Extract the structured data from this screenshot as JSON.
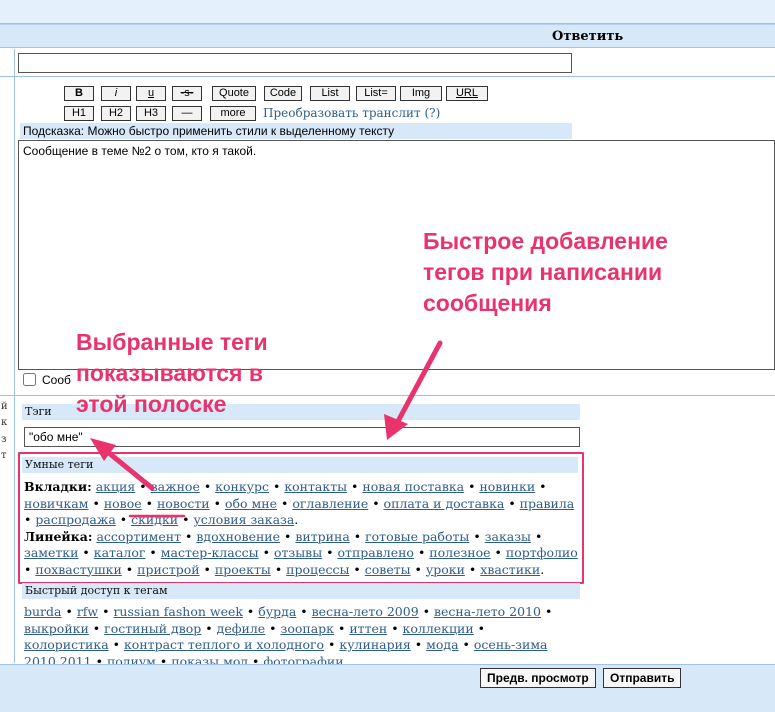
{
  "header": {
    "title": "Ответить"
  },
  "subject": {
    "value": ""
  },
  "toolbar": {
    "row1": [
      "B",
      "i",
      "u",
      "-s-",
      "Quote",
      "Code",
      "List",
      "List=",
      "Img",
      "URL"
    ],
    "row2": [
      "H1",
      "H2",
      "H3",
      "—",
      "more"
    ],
    "translit": "Преобразовать транслит (?)"
  },
  "hint": "Подсказка: Можно быстро применить стили к выделенному тексту",
  "message": {
    "value": "Сообщение в теме №2 о том, кто я такой."
  },
  "signature_label": "Сооб",
  "sidebar_marks": [
    "й",
    "к",
    "з",
    "т"
  ],
  "tags": {
    "section_title": "Тэги",
    "value": "\"обо мне\""
  },
  "smart_tags": {
    "title": "Умные теги",
    "groups": [
      {
        "label": "Вкладки:",
        "items": [
          "акция",
          "важное",
          "конкурс",
          "контакты",
          "новая поставка",
          "новинки",
          "новичкам",
          "новое",
          "новости",
          "обо мне",
          "оглавление",
          "оплата и доставка",
          "правила",
          "распродажа",
          "скидки",
          "условия заказа"
        ]
      },
      {
        "label": "Линейка:",
        "items": [
          "ассортимент",
          "вдохновение",
          "витрина",
          "готовые работы",
          "заказы",
          "заметки",
          "каталог",
          "мастер-классы",
          "отзывы",
          "отправлено",
          "полезное",
          "портфолио",
          "похвастушки",
          "пристрой",
          "проекты",
          "процессы",
          "советы",
          "уроки",
          "хвастики"
        ]
      }
    ]
  },
  "quick_tags": {
    "title": "Быстрый доступ к тегам",
    "items": [
      "burda",
      "rfw",
      "russian fashon week",
      "бурда",
      "весна-лето 2009",
      "весна-лето 2010",
      "выкройки",
      "гостиный двор",
      "дефиле",
      "зоопарк",
      "иттен",
      "коллекции",
      "колористика",
      "контраст теплого и холодного",
      "кулинария",
      "мода",
      "осень-зима 2010 2011",
      "подиум",
      "показы мод",
      "фотографии"
    ]
  },
  "buttons": {
    "preview": "Предв. просмотр",
    "submit": "Отправить"
  },
  "annotations": {
    "callout_right": [
      "Быстрое добавление",
      "тегов при написании",
      "сообщения"
    ],
    "callout_left": [
      "Выбранные теги",
      "показываются в",
      "этой полоске"
    ],
    "color": "#e8336d"
  },
  "colors": {
    "header_bg": "#d7e8f8",
    "link": "#2f5d8a",
    "annotation": "#e8336d"
  }
}
